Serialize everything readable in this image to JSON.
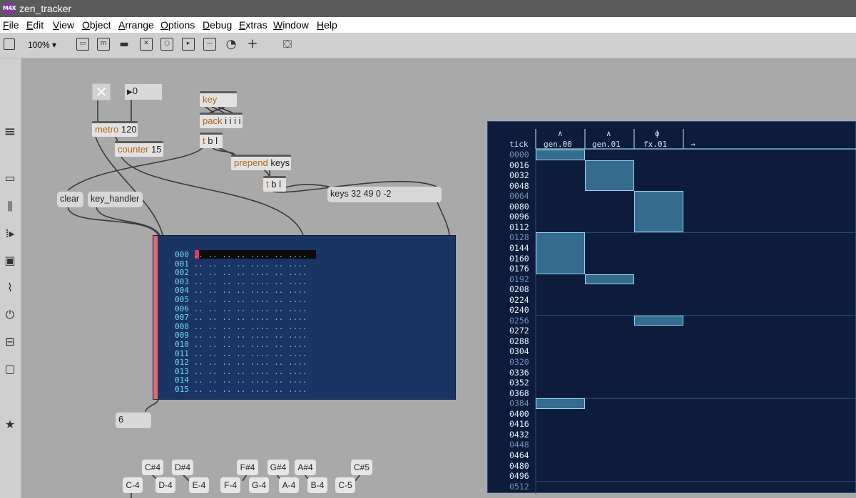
{
  "window": {
    "title": "zen_tracker",
    "logo": "M4X"
  },
  "menu": [
    "File",
    "Edit",
    "View",
    "Object",
    "Arrange",
    "Options",
    "Debug",
    "Extras",
    "Window",
    "Help"
  ],
  "toolbar": {
    "zoom": "100%",
    "zoom_arrow": "▾"
  },
  "patch": {
    "toggle_symbol": "✕",
    "num_init": "0",
    "num_arrow": "▶",
    "metro": {
      "name": "metro",
      "arg": "120"
    },
    "counter": {
      "name": "counter",
      "arg": "15"
    },
    "key": {
      "name": "key"
    },
    "pack": {
      "name": "pack",
      "arg": "i i i i"
    },
    "tbl1": {
      "name": "t",
      "arg": "b l"
    },
    "prepend": {
      "name": "prepend",
      "arg": "keys"
    },
    "tbl2": {
      "name": "t",
      "arg": "b l"
    },
    "msg_clear": "clear",
    "msg_key_handler": "key_handler",
    "msg_keys": "keys 32 49 0 -2",
    "num_six": "6",
    "keyboard": {
      "top": [
        "C#4",
        "D#4",
        "F#4",
        "G#4",
        "A#4",
        "C#5"
      ],
      "bottom": [
        "C-4",
        "D-4",
        "E-4",
        "F-4",
        "G-4",
        "A-4",
        "B-4",
        "C-5"
      ]
    }
  },
  "tracker": {
    "rows": [
      {
        "n": "000",
        "d": ".. .. .. .. .... .. ...."
      },
      {
        "n": "001",
        "d": ".. .. .. .. .... .. ...."
      },
      {
        "n": "002",
        "d": ".. .. .. .. .... .. ...."
      },
      {
        "n": "003",
        "d": ".. .. .. .. .... .. ...."
      },
      {
        "n": "004",
        "d": ".. .. .. .. .... .. ...."
      },
      {
        "n": "005",
        "d": ".. .. .. .. .... .. ...."
      },
      {
        "n": "006",
        "d": ".. .. .. .. .... .. ...."
      },
      {
        "n": "007",
        "d": ".. .. .. .. .... .. ...."
      },
      {
        "n": "008",
        "d": ".. .. .. .. .... .. ...."
      },
      {
        "n": "009",
        "d": ".. .. .. .. .... .. ...."
      },
      {
        "n": "010",
        "d": ".. .. .. .. .... .. ...."
      },
      {
        "n": "011",
        "d": ".. .. .. .. .... .. ...."
      },
      {
        "n": "012",
        "d": ".. .. .. .. .... .. ...."
      },
      {
        "n": "013",
        "d": ".. .. .. .. .... .. ...."
      },
      {
        "n": "014",
        "d": ".. .. .. .. .... .. ...."
      },
      {
        "n": "015",
        "d": ".. .. .. .. .... .. ...."
      }
    ]
  },
  "timeline": {
    "tick_label": "tick",
    "tracks": [
      {
        "marker": "∧",
        "name": "gen.00"
      },
      {
        "marker": "∧",
        "name": "gen.01"
      },
      {
        "marker": "ϕ",
        "name": "fx.01"
      }
    ],
    "add_arrow": "→",
    "ticks": [
      "0000",
      "0016",
      "0032",
      "0048",
      "0064",
      "0080",
      "0096",
      "0112",
      "0128",
      "0144",
      "0160",
      "0176",
      "0192",
      "0208",
      "0224",
      "0240",
      "0256",
      "0272",
      "0288",
      "0304",
      "0320",
      "0336",
      "0352",
      "0368",
      "0384",
      "0400",
      "0416",
      "0432",
      "0448",
      "0464",
      "0480",
      "0496",
      "0512"
    ],
    "colors": {
      "beat_tick": "#6f8fb0",
      "tick": "#e8f2fa",
      "block_fill": "#356b8c",
      "block_border": "#8fd6f0",
      "bg": "#0e1c3c"
    },
    "blocks": [
      {
        "track": 0,
        "start": 0,
        "end": 16
      },
      {
        "track": 1,
        "start": 16,
        "end": 64
      },
      {
        "track": 2,
        "start": 64,
        "end": 128
      },
      {
        "track": 0,
        "start": 128,
        "end": 192
      },
      {
        "track": 1,
        "start": 192,
        "end": 208
      },
      {
        "track": 2,
        "start": 256,
        "end": 272
      },
      {
        "track": 0,
        "start": 384,
        "end": 400
      }
    ]
  }
}
